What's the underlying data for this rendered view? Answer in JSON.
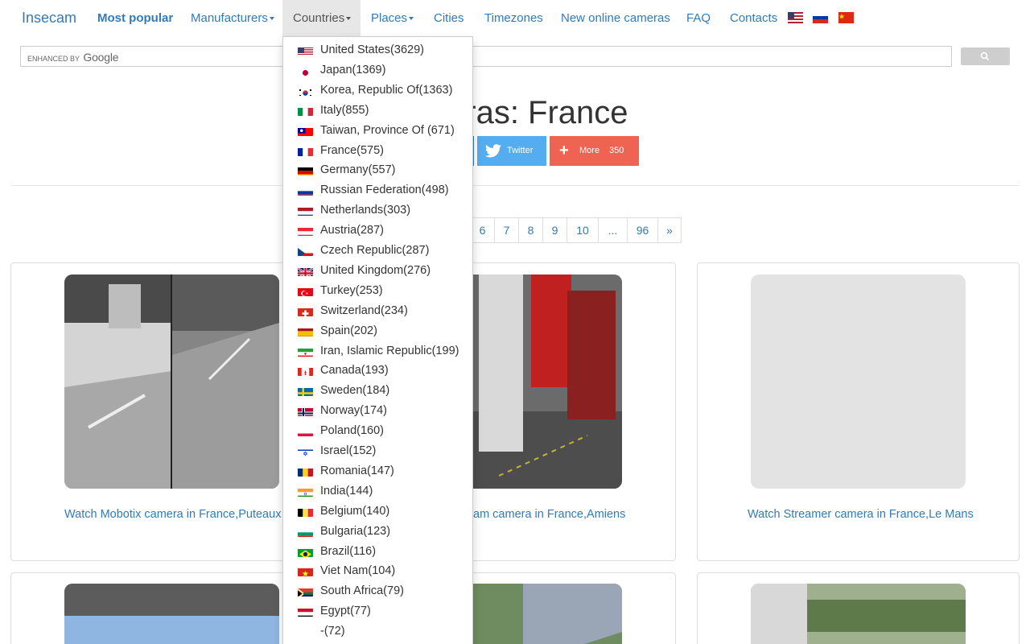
{
  "brand": "Insecam",
  "nav": {
    "most_popular": "Most popular",
    "manufacturers": "Manufacturers",
    "countries": "Countries",
    "places": "Places",
    "cities": "Cities",
    "timezones": "Timezones",
    "new_online": "New online cameras",
    "faq": "FAQ",
    "contacts": "Contacts"
  },
  "search": {
    "enhanced_by": "ENHANCED BY",
    "google": "Google"
  },
  "heading": "eras: France",
  "share": {
    "twitter": "Twitter",
    "more": "More",
    "more_count": "350"
  },
  "pagination": [
    "6",
    "7",
    "8",
    "9",
    "10",
    "...",
    "96",
    "»"
  ],
  "cameras": [
    {
      "link": "Watch Mobotix camera in France,Puteaux"
    },
    {
      "link": "am camera in France,Amiens"
    },
    {
      "link": "Watch Streamer camera in France,Le Mans"
    }
  ],
  "countries": [
    {
      "label": "United States(3629)",
      "flag": "us"
    },
    {
      "label": "Japan(1369)",
      "flag": "jp"
    },
    {
      "label": "Korea, Republic Of(1363)",
      "flag": "kr"
    },
    {
      "label": "Italy(855)",
      "flag": "it"
    },
    {
      "label": "Taiwan, Province Of (671)",
      "flag": "tw"
    },
    {
      "label": "France(575)",
      "flag": "fr"
    },
    {
      "label": "Germany(557)",
      "flag": "de"
    },
    {
      "label": "Russian Federation(498)",
      "flag": "ru"
    },
    {
      "label": "Netherlands(303)",
      "flag": "nl"
    },
    {
      "label": "Austria(287)",
      "flag": "at"
    },
    {
      "label": "Czech Republic(287)",
      "flag": "cz"
    },
    {
      "label": "United Kingdom(276)",
      "flag": "gb"
    },
    {
      "label": "Turkey(253)",
      "flag": "tr"
    },
    {
      "label": "Switzerland(234)",
      "flag": "ch"
    },
    {
      "label": "Spain(202)",
      "flag": "es"
    },
    {
      "label": "Iran, Islamic Republic(199)",
      "flag": "ir"
    },
    {
      "label": "Canada(193)",
      "flag": "ca"
    },
    {
      "label": "Sweden(184)",
      "flag": "se"
    },
    {
      "label": "Norway(174)",
      "flag": "no"
    },
    {
      "label": "Poland(160)",
      "flag": "pl"
    },
    {
      "label": "Israel(152)",
      "flag": "il"
    },
    {
      "label": "Romania(147)",
      "flag": "ro"
    },
    {
      "label": "India(144)",
      "flag": "in"
    },
    {
      "label": "Belgium(140)",
      "flag": "be"
    },
    {
      "label": "Bulgaria(123)",
      "flag": "bg"
    },
    {
      "label": "Brazil(116)",
      "flag": "br"
    },
    {
      "label": "Viet Nam(104)",
      "flag": "vn"
    },
    {
      "label": "South Africa(79)",
      "flag": "za"
    },
    {
      "label": "Egypt(77)",
      "flag": "eg"
    },
    {
      "label": "-(72)",
      "flag": ""
    }
  ]
}
